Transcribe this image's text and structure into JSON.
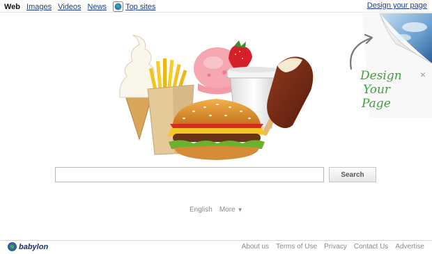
{
  "nav": {
    "items": [
      {
        "label": "Web",
        "active": true
      },
      {
        "label": "Images",
        "active": false
      },
      {
        "label": "Videos",
        "active": false
      },
      {
        "label": "News",
        "active": false
      }
    ],
    "top_sites": "Top sites",
    "design_link": "Design your page"
  },
  "design_corner": {
    "lines": [
      "Design",
      "Your",
      "Page"
    ],
    "close_icon": "×"
  },
  "search": {
    "input_value": "",
    "button_label": "Search"
  },
  "language": {
    "current": "English",
    "more": "More",
    "more_arrow": "▼"
  },
  "footer": {
    "logo_text": "babylon",
    "links": [
      "About us",
      "Terms of Use",
      "Privacy",
      "Contact Us",
      "Advertise"
    ]
  },
  "colors": {
    "link": "#1a3d9c",
    "design_green": "#3ea13a",
    "logo_blue": "#1a2d6a"
  },
  "icons": [
    "globe-icon",
    "page-curl-icon",
    "curved-arrow-icon",
    "close-icon",
    "babylon-logo-icon",
    "chevron-down-icon"
  ]
}
